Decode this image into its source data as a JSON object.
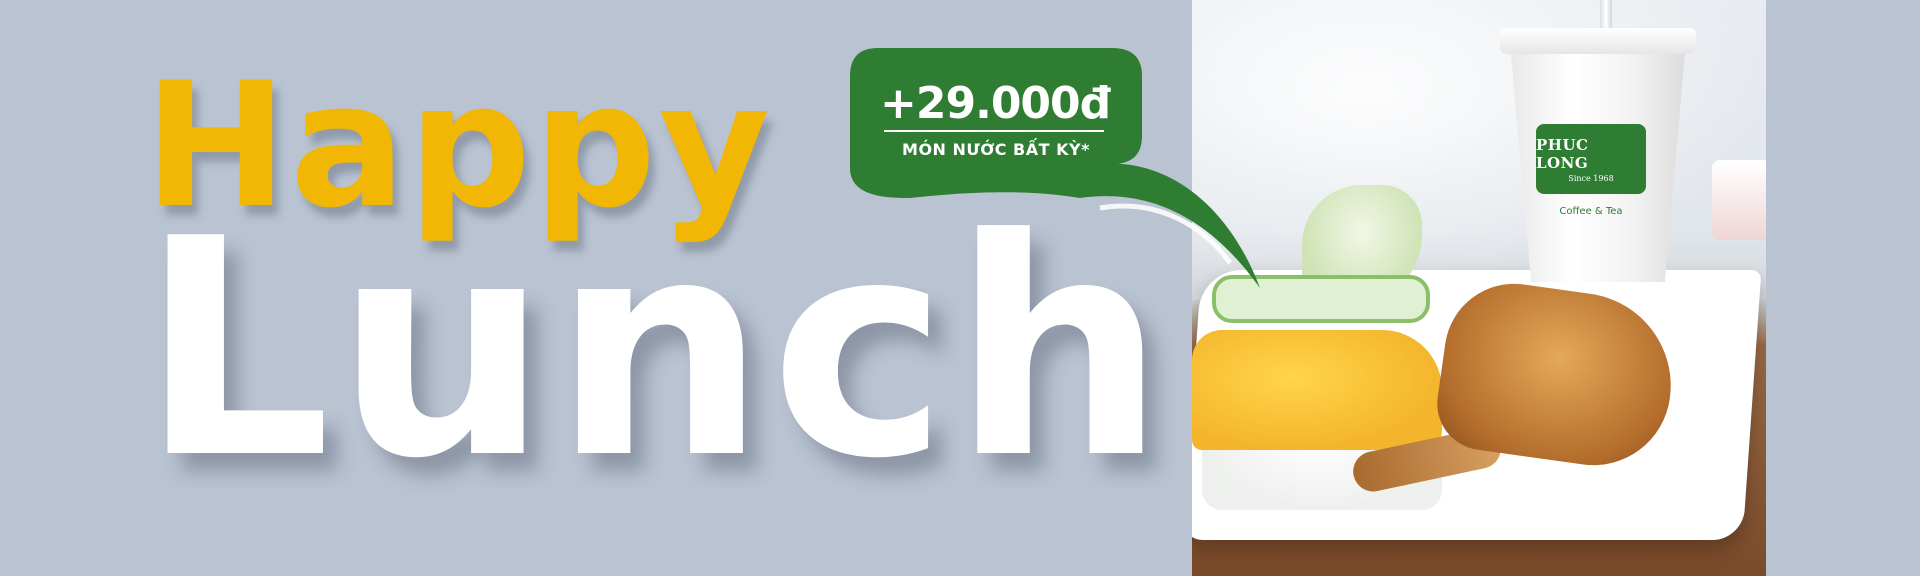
{
  "headline": {
    "line1": "Happy",
    "line2": "Lunch"
  },
  "promo": {
    "price": "+29.000đ",
    "subtitle": "MÓN NƯỚC BẤT KỲ*"
  },
  "photo": {
    "brand_name": "PHUC LONG",
    "brand_since": "Since 1968",
    "brand_tagline": "Coffee & Tea"
  },
  "colors": {
    "background": "#b9c3d1",
    "headline_yellow": "#f2b705",
    "headline_white": "#ffffff",
    "bubble_green": "#2e7d32"
  }
}
